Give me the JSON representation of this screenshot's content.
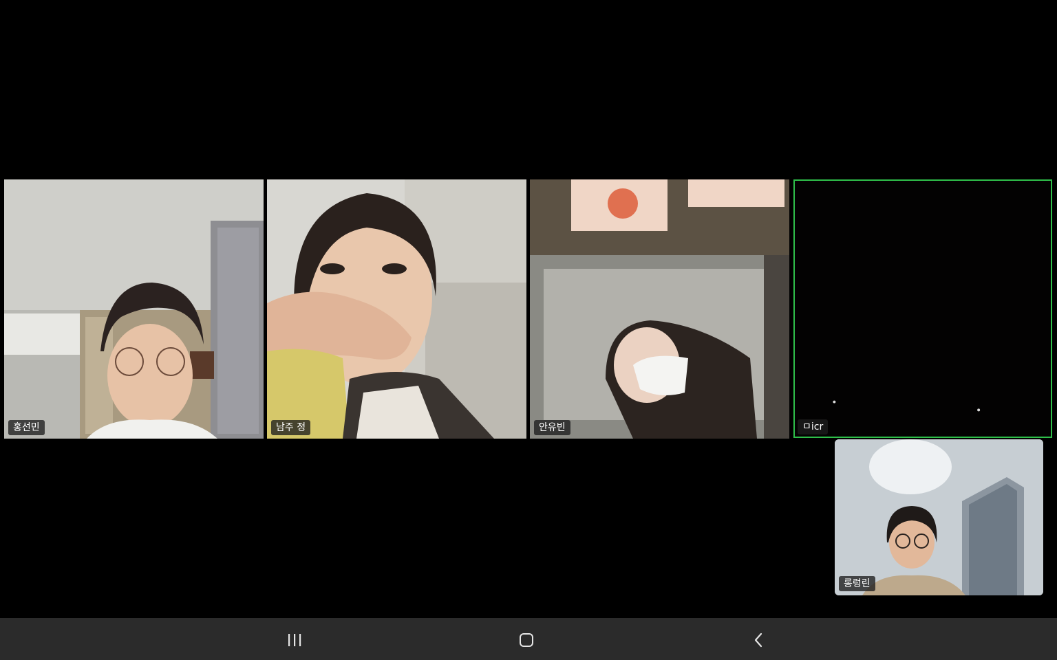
{
  "participants": [
    {
      "name": "홍선민",
      "active_speaker": false
    },
    {
      "name": "남주 정",
      "active_speaker": false
    },
    {
      "name": "안유빈",
      "active_speaker": false
    },
    {
      "name": "ㅁicr",
      "active_speaker": true
    }
  ],
  "self_view": {
    "name": "롱렁린"
  },
  "colors": {
    "active_border": "#2fbf4a",
    "background": "#000000",
    "navbar": "#2b2b2b"
  },
  "navbar": {
    "recent_icon": "recent-apps-icon",
    "home_icon": "home-icon",
    "back_icon": "back-icon"
  }
}
